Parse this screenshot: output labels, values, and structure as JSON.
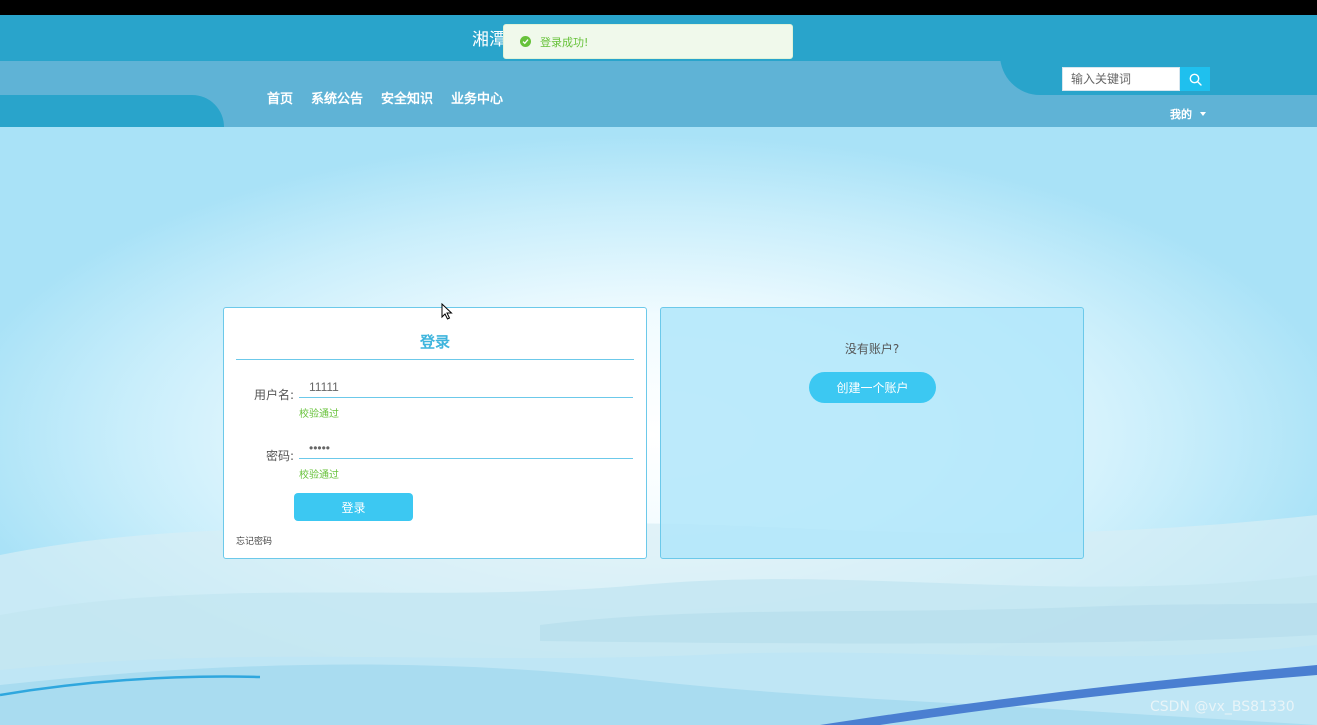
{
  "site": {
    "title": "湘潭"
  },
  "toast": {
    "message": "登录成功!"
  },
  "nav": {
    "items": [
      {
        "label": "首页"
      },
      {
        "label": "系统公告"
      },
      {
        "label": "安全知识"
      },
      {
        "label": "业务中心"
      }
    ]
  },
  "search": {
    "placeholder": "输入关键词",
    "icon": "search-icon"
  },
  "user_menu": {
    "label": "我的",
    "icon": "caret-down-icon"
  },
  "login": {
    "title": "登录",
    "username_label": "用户名:",
    "username_value": "11111",
    "username_status": "校验通过",
    "password_label": "密码:",
    "password_value": "•••••",
    "password_status": "校验通过",
    "submit_label": "登录",
    "forgot_label": "忘记密码"
  },
  "register": {
    "question": "没有账户?",
    "button_label": "创建一个账户"
  },
  "watermark": "CSDN @vx_BS81330",
  "colors": {
    "header": "#29a4cb",
    "nav_band": "#5fb3d6",
    "accent": "#3cc8f2",
    "success": "#67c23a"
  }
}
